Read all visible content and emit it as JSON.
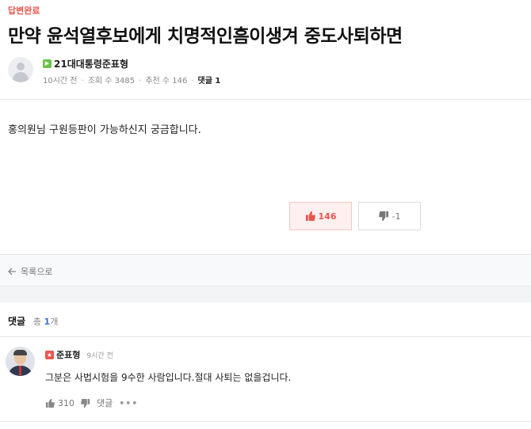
{
  "post": {
    "badge": "답변완료",
    "title": "만약 윤석열후보에게 치명적인흠이생겨 중도사퇴하면",
    "author": {
      "level_icon": "green-level-icon",
      "name": "21대대통령준표형",
      "avatar_icon": "default-user-avatar-icon"
    },
    "meta": {
      "time": "10시간 전",
      "views_label": "조회 수 3485",
      "recommend_label": "추천 수 146",
      "comments_label": "댓글 1"
    },
    "body": "홍의원님 구원등판이 가능하신지 궁금합니다.",
    "votes": {
      "up": "146",
      "down": "-1"
    }
  },
  "nav": {
    "back_label": "목록으로"
  },
  "comments": {
    "label": "댓글",
    "total_prefix": "총 ",
    "count": "1",
    "suffix": "개",
    "items": [
      {
        "level_icon": "red-level-icon",
        "name": "준표형",
        "time": "9시간 전",
        "text": "그분은 사법시험을 9수한 사람입니다.절대 사퇴는 없을겁니다.",
        "likes": "310",
        "reply_label": "댓글",
        "more": "•••"
      }
    ]
  },
  "colors": {
    "accent_red": "#e8554e",
    "link_blue": "#3b6fd8",
    "level_green": "#6cc24a"
  }
}
